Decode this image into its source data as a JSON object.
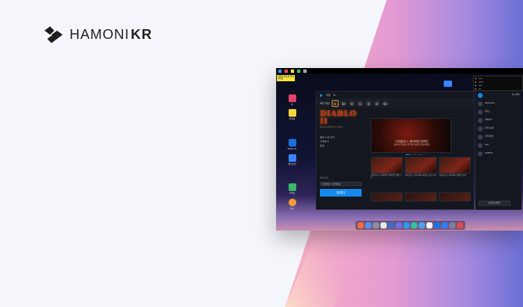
{
  "brand": {
    "name": "HAMONI",
    "suffix": "KR",
    "accent": "#1d1d1f"
  },
  "screenshot": {
    "sticky_note": "새로운 메모를 입력하세요",
    "desktop_icons": [
      {
        "name": "home-folder",
        "label": "홈",
        "color": "#e2436a"
      },
      {
        "name": "recycle",
        "label": "휴지통",
        "color": "#f6d63c"
      },
      {
        "name": "battlenet",
        "label": "Battle.net",
        "color": "#1a6fd9"
      },
      {
        "name": "app",
        "label": "앱스토어",
        "color": "#3a86ff"
      },
      {
        "name": "terminal",
        "label": "터미널",
        "color": "#39b86b"
      },
      {
        "name": "weather",
        "label": "날씨",
        "color": "#f29b38"
      }
    ],
    "launcher": {
      "tabs": [
        "게임",
        "쇼",
        "..."
      ],
      "game_menu": "모든 게임",
      "game_icons": [
        "D",
        "W",
        "H",
        "O",
        "S",
        "D",
        "SC"
      ],
      "game_title": "DIABLO",
      "game_title_2": "II",
      "game_subtitle": "RESURRECTED",
      "left_menu": [
        "패치 노트 보기",
        "구매하기",
        "옵션"
      ],
      "version_label": "게임 버전",
      "region_select": "디아블로 II: 레저렉션",
      "play_button": "플레이",
      "banner_title": "디아블로 II: 레저렉션 정복전",
      "banner_subtitle": "정복자의 위대한 전투에서 영웅을 증명하세요",
      "news": [
        {
          "title": "디아블로 II: 레저렉션 업데이트 패치 노트"
        },
        {
          "title": "디아블로 II: 레저렉션 새로운 시즌 시작"
        },
        {
          "title": "디아블로 II: 레저렉션 이벤트 안내"
        }
      ]
    },
    "friends": {
      "header": "친구 목록",
      "list": [
        {
          "name": "Nightbearer"
        },
        {
          "name": "레전드"
        },
        {
          "name": "게이머77"
        },
        {
          "name": "블리자드팬"
        },
        {
          "name": "전투의달인"
        },
        {
          "name": "Kiria"
        },
        {
          "name": "HAMONI"
        }
      ],
      "chat_button": "새 대화 만들기"
    },
    "dock_colors": [
      "#f26b3a",
      "#5b8def",
      "#8a8fa0",
      "#e8e8e8",
      "#3f6bd1",
      "#6c71e4",
      "#2b9af3",
      "#34c2a4",
      "#4aa3f0",
      "#f2f2f2",
      "#1b73e8",
      "#2d7ef7",
      "#7a7fa0",
      "#e04a4a"
    ]
  }
}
